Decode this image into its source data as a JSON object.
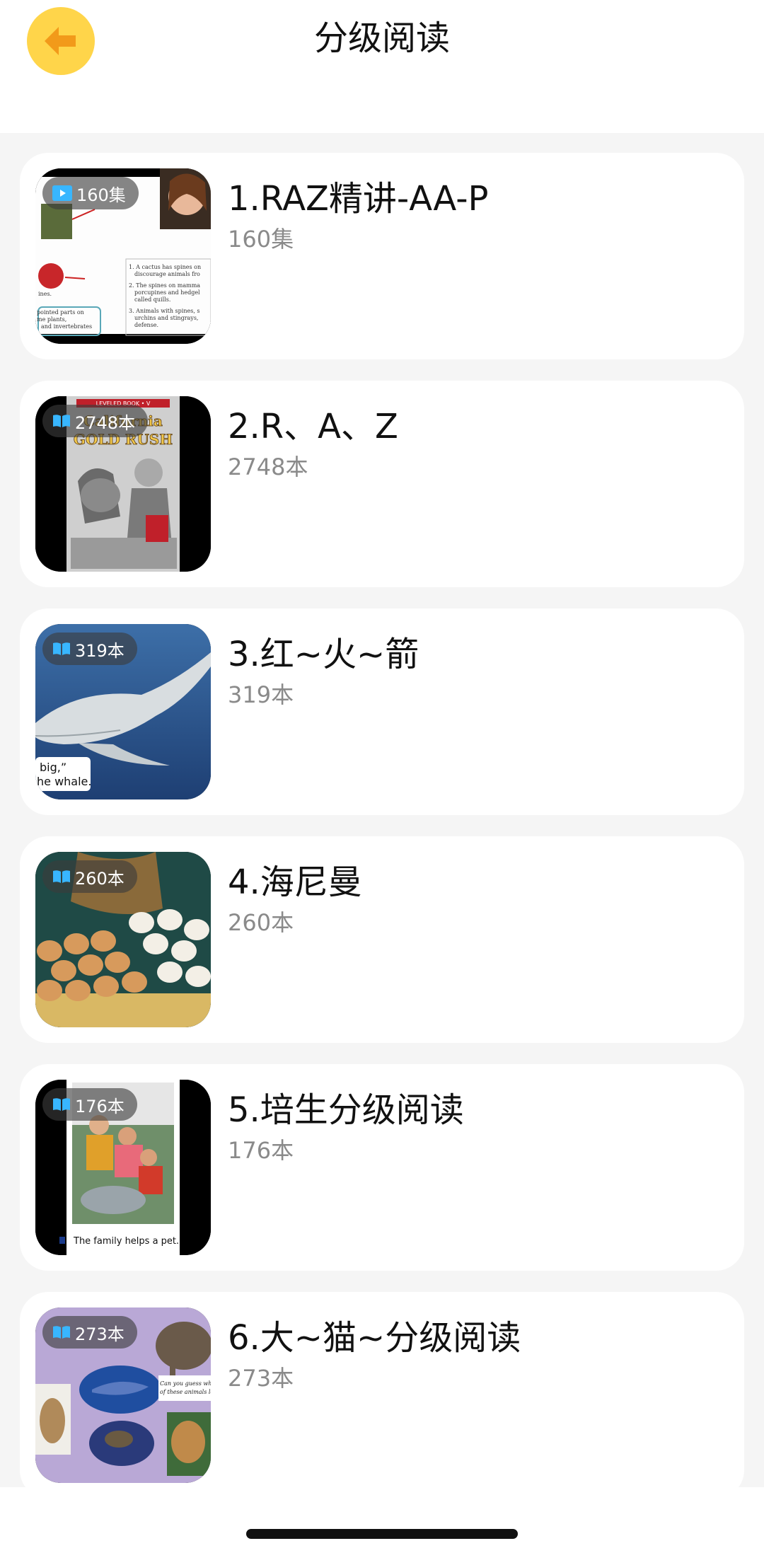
{
  "header": {
    "title": "分级阅读"
  },
  "items": [
    {
      "title": "1.RAZ精讲-AA-P",
      "subtitle": "160集",
      "badge": "160集",
      "badge_icon": "video-icon"
    },
    {
      "title": "2.R、A、Z",
      "subtitle": "2748本",
      "badge": "2748本",
      "badge_icon": "book-icon"
    },
    {
      "title": "3.红~火~箭",
      "subtitle": "319本",
      "badge": "319本",
      "badge_icon": "book-icon"
    },
    {
      "title": "4.海尼曼",
      "subtitle": "260本",
      "badge": "260本",
      "badge_icon": "book-icon"
    },
    {
      "title": "5.培生分级阅读",
      "subtitle": "176本",
      "badge": "176本",
      "badge_icon": "book-icon"
    },
    {
      "title": "6.大~猫~分级阅读",
      "subtitle": "273本",
      "badge": "273本",
      "badge_icon": "book-icon"
    }
  ],
  "thumbnails": {
    "1": {
      "texts": [
        "1.  A cactus has spines on",
        "discourage animals fro",
        "2.  The spines on mamma",
        "porcupines and hedgel",
        "called quills.",
        "3.  Animals with spines, s",
        "urchins and stingrays,",
        "defense.",
        "pointed parts on",
        "me plants,",
        "and invertebrates",
        "ines."
      ]
    },
    "2": {
      "texts": [
        "LEVELED BOOK • V",
        "California",
        "GOLD RUSH"
      ]
    },
    "3": {
      "texts": [
        "big,”",
        "he whale."
      ]
    },
    "5": {
      "texts": [
        "The family helps a pet."
      ]
    },
    "6": {
      "texts": [
        "Can you guess what the ances",
        "of these animals looked like?"
      ]
    }
  },
  "colors": {
    "accent": "#FFD54A",
    "arrow": "#F29A1A",
    "background": "#F5F5F5",
    "card": "#FFFFFF",
    "subtitle": "#8A8A8A"
  }
}
